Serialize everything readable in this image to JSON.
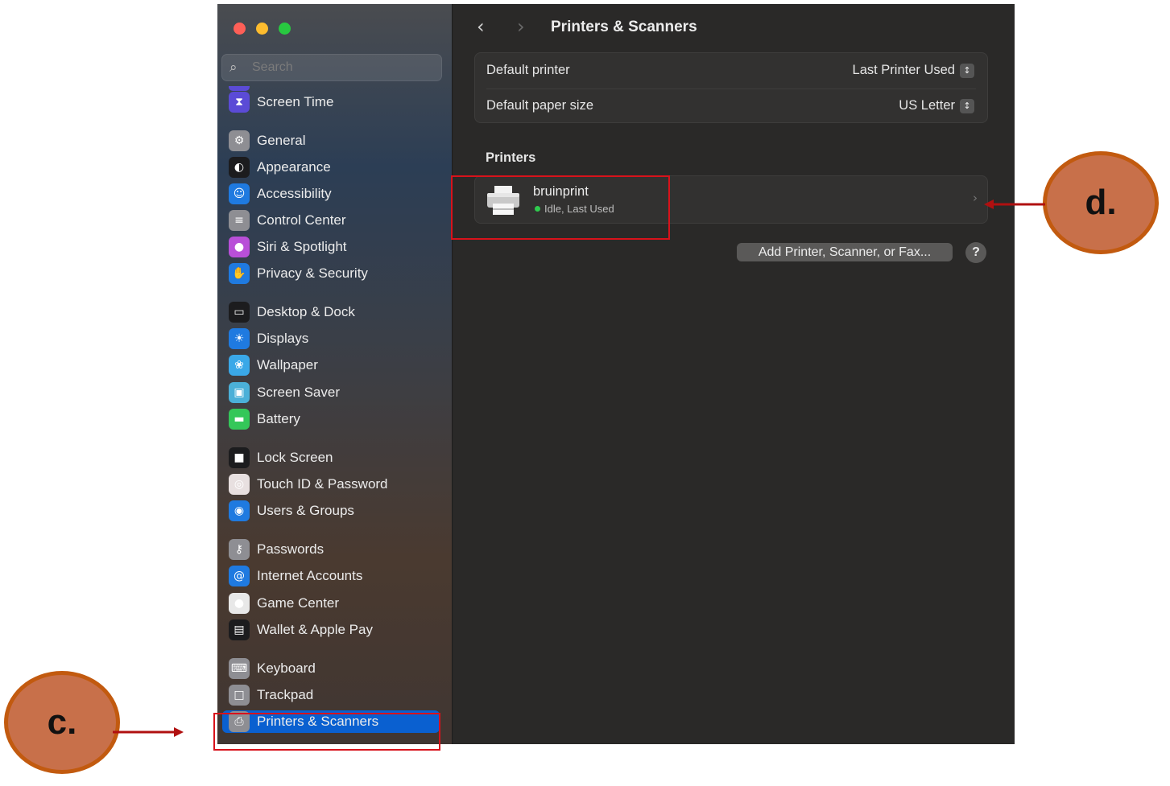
{
  "window": {
    "title": "Printers & Scanners"
  },
  "search": {
    "placeholder": "Search"
  },
  "sidebar": {
    "items": [
      {
        "label": "Screen Time",
        "icon": "hourglass-icon",
        "color": "#5b4bd6"
      },
      {
        "label": "General",
        "icon": "gear-icon",
        "color": "#8e8e93"
      },
      {
        "label": "Appearance",
        "icon": "appearance-icon",
        "color": "#1c1c1e"
      },
      {
        "label": "Accessibility",
        "icon": "accessibility-icon",
        "color": "#1f7ae0"
      },
      {
        "label": "Control Center",
        "icon": "control-center-icon",
        "color": "#8e8e93"
      },
      {
        "label": "Siri & Spotlight",
        "icon": "siri-icon",
        "color": "#b84fd8"
      },
      {
        "label": "Privacy & Security",
        "icon": "hand-icon",
        "color": "#1f7ae0"
      },
      {
        "label": "Desktop & Dock",
        "icon": "dock-icon",
        "color": "#1c1c1e"
      },
      {
        "label": "Displays",
        "icon": "sun-icon",
        "color": "#1f7ae0"
      },
      {
        "label": "Wallpaper",
        "icon": "flower-icon",
        "color": "#3aa8e8"
      },
      {
        "label": "Screen Saver",
        "icon": "screen-saver-icon",
        "color": "#4bb0d8"
      },
      {
        "label": "Battery",
        "icon": "battery-icon",
        "color": "#34c759"
      },
      {
        "label": "Lock Screen",
        "icon": "lock-icon",
        "color": "#1c1c1e"
      },
      {
        "label": "Touch ID & Password",
        "icon": "fingerprint-icon",
        "color": "#e8e0e0"
      },
      {
        "label": "Users & Groups",
        "icon": "users-icon",
        "color": "#1f7ae0"
      },
      {
        "label": "Passwords",
        "icon": "key-icon",
        "color": "#8e8e93"
      },
      {
        "label": "Internet Accounts",
        "icon": "at-icon",
        "color": "#1f7ae0"
      },
      {
        "label": "Game Center",
        "icon": "game-center-icon",
        "color": "#e8e8e8"
      },
      {
        "label": "Wallet & Apple Pay",
        "icon": "wallet-icon",
        "color": "#1c1c1e"
      },
      {
        "label": "Keyboard",
        "icon": "keyboard-icon",
        "color": "#8e8e93"
      },
      {
        "label": "Trackpad",
        "icon": "trackpad-icon",
        "color": "#8e8e93"
      },
      {
        "label": "Printers & Scanners",
        "icon": "printer-icon",
        "color": "#8e8e93",
        "selected": true
      }
    ]
  },
  "settings": {
    "default_printer_label": "Default printer",
    "default_printer_value": "Last Printer Used",
    "paper_size_label": "Default paper size",
    "paper_size_value": "US Letter"
  },
  "printers": {
    "section_title": "Printers",
    "list": [
      {
        "name": "bruinprint",
        "status": "Idle, Last Used"
      }
    ]
  },
  "add_button": "Add Printer, Scanner, or Fax...",
  "help_button": "?",
  "callouts": {
    "c": "c.",
    "d": "d."
  },
  "colors": {
    "selection": "#0a60d0",
    "highlight_box": "#d8121b",
    "callout_fill": "#c8704a"
  }
}
